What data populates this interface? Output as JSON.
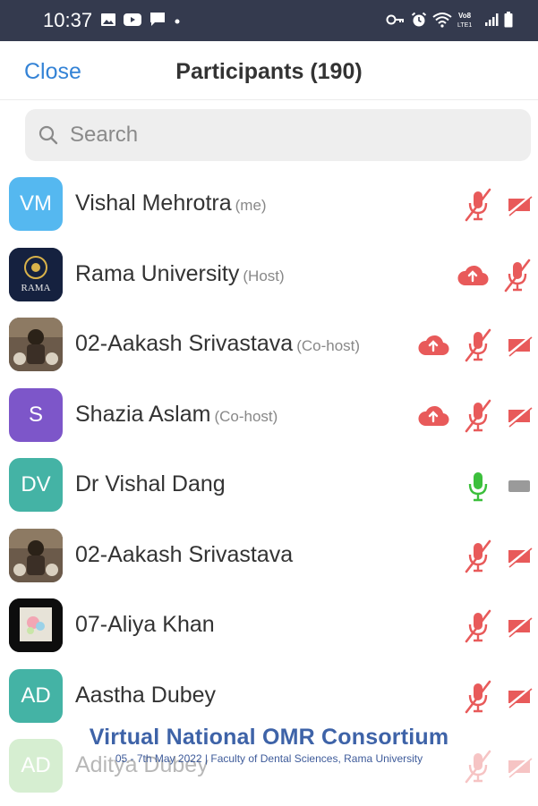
{
  "status_bar": {
    "time": "10:37",
    "left_icons": [
      "image-icon",
      "youtube-icon",
      "message-icon",
      "dot-icon"
    ],
    "right_icons": [
      "key-icon",
      "alarm-icon",
      "wifi-icon",
      "volte-icon",
      "signal-icon",
      "battery-icon"
    ],
    "volte_label": "Vo8 LTE1"
  },
  "header": {
    "close_label": "Close",
    "title": "Participants (190)"
  },
  "search": {
    "placeholder": "Search"
  },
  "colors": {
    "accent": "#3483d6",
    "muted_red": "#e85a5a",
    "mic_green": "#3cbf3c",
    "video_grey": "#9a9a9a"
  },
  "participants": [
    {
      "initials": "VM",
      "name": "Vishal Mehrotra",
      "role": "(me)",
      "avatar_color": "#55b8f0",
      "avatar_type": "initials",
      "cloud": false,
      "mic": "muted",
      "video": "off"
    },
    {
      "initials": "",
      "name": "Rama University",
      "role": "(Host)",
      "avatar_color": "#1c2a4e",
      "avatar_type": "logo",
      "logo_text": "RAMA",
      "cloud": true,
      "mic": "muted",
      "video": "none"
    },
    {
      "initials": "",
      "name": "02-Aakash Srivastava",
      "role": "(Co-host)",
      "avatar_color": "#5a4a3e",
      "avatar_type": "photo",
      "cloud": true,
      "mic": "muted",
      "video": "off"
    },
    {
      "initials": "S",
      "name": "Shazia Aslam",
      "role": "(Co-host)",
      "avatar_color": "#7d56c9",
      "avatar_type": "initials",
      "cloud": true,
      "mic": "muted",
      "video": "off"
    },
    {
      "initials": "DV",
      "name": "Dr Vishal Dang",
      "role": "",
      "avatar_color": "#44b3a5",
      "avatar_type": "initials",
      "cloud": false,
      "mic": "on",
      "video": "grey"
    },
    {
      "initials": "",
      "name": "02-Aakash Srivastava",
      "role": "",
      "avatar_color": "#5a4a3e",
      "avatar_type": "photo",
      "cloud": false,
      "mic": "muted",
      "video": "off"
    },
    {
      "initials": "",
      "name": "07-Aliya Khan",
      "role": "",
      "avatar_color": "#101010",
      "avatar_type": "picture",
      "cloud": false,
      "mic": "muted",
      "video": "off"
    },
    {
      "initials": "AD",
      "name": "Aastha Dubey",
      "role": "",
      "avatar_color": "#44b3a5",
      "avatar_type": "initials",
      "cloud": false,
      "mic": "muted",
      "video": "off"
    },
    {
      "initials": "AD",
      "name": "Aditya Dubey",
      "role": "",
      "avatar_color": "#8ccf7e",
      "avatar_type": "initials",
      "cloud": false,
      "mic": "muted",
      "video": "off",
      "faded": true
    }
  ],
  "watermark": {
    "title": "Virtual National OMR Consortium",
    "subtitle": "05 - 7th May 2022  | Faculty of Dental Sciences, Rama University"
  }
}
